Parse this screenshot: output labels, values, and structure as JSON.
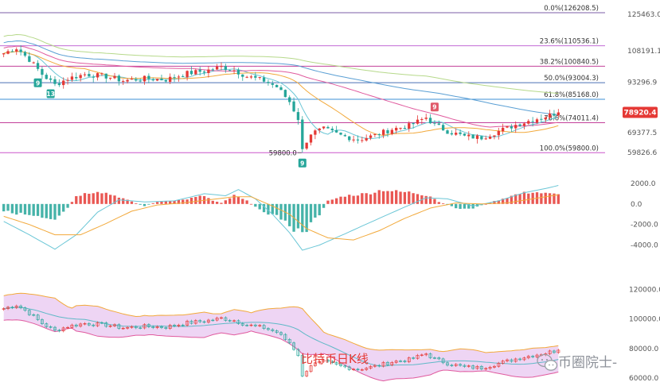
{
  "chart_data": [
    {
      "type": "candlestick",
      "panel": "price",
      "title": "",
      "ylim": [
        55000,
        130000
      ],
      "y_ticks": [
        "125463.0",
        "108191.1",
        "93296.9",
        "69377.5",
        "59826.6"
      ],
      "y_tick_values": [
        125463,
        108191.1,
        93296.9,
        69377.5,
        59826.6
      ],
      "fib_levels": [
        {
          "label": "0.0%(126208.5)",
          "value": 126208.5,
          "color": "#7b5ea7"
        },
        {
          "label": "23.6%(110536.1)",
          "value": 110536.1,
          "color": "#c26bd6"
        },
        {
          "label": "38.2%(100840.5)",
          "value": 100840.5,
          "color": "#c2409a"
        },
        {
          "label": "50.0%(93004.3)",
          "value": 93004.3,
          "color": "#4a6fb5"
        },
        {
          "label": "61.8%(85168.0)",
          "value": 85168.0,
          "color": "#3d8fd6"
        },
        {
          "label": "78.6%(74011.4)",
          "value": 74011.4,
          "color": "#c2409a"
        },
        {
          "label": "100.0%(59800.0)",
          "value": 59800.0,
          "color": "#cc55cc"
        }
      ],
      "last_price": {
        "label": "78920.4",
        "value": 78920.4,
        "color": "#e53935"
      },
      "low_annotation": {
        "label": "59800.0",
        "value": 59800.0
      },
      "td_markers": [
        {
          "label": "9",
          "kind": "buy",
          "candle": 8
        },
        {
          "label": "13",
          "kind": "buy",
          "candle": 11
        },
        {
          "label": "9",
          "kind": "buy",
          "candle": 70
        },
        {
          "label": "9",
          "kind": "sell",
          "candle": 101
        }
      ],
      "close_path": [
        {
          "candle": 0,
          "value": 107000
        },
        {
          "candle": 3,
          "value": 109500
        },
        {
          "candle": 6,
          "value": 104000
        },
        {
          "candle": 9,
          "value": 97000
        },
        {
          "candle": 12,
          "value": 92000
        },
        {
          "candle": 15,
          "value": 95000
        },
        {
          "candle": 19,
          "value": 97000
        },
        {
          "candle": 24,
          "value": 96000
        },
        {
          "candle": 28,
          "value": 94000
        },
        {
          "candle": 33,
          "value": 95000
        },
        {
          "candle": 38,
          "value": 94500
        },
        {
          "candle": 43,
          "value": 97500
        },
        {
          "candle": 47,
          "value": 98500
        },
        {
          "candle": 51,
          "value": 100500
        },
        {
          "candle": 54,
          "value": 99000
        },
        {
          "candle": 57,
          "value": 96000
        },
        {
          "candle": 61,
          "value": 94000
        },
        {
          "candle": 64,
          "value": 91000
        },
        {
          "candle": 67,
          "value": 84000
        },
        {
          "candle": 69,
          "value": 76000
        },
        {
          "candle": 70,
          "value": 62000
        },
        {
          "candle": 72,
          "value": 69000
        },
        {
          "candle": 75,
          "value": 71000
        },
        {
          "candle": 79,
          "value": 68000
        },
        {
          "candle": 83,
          "value": 66000
        },
        {
          "candle": 87,
          "value": 68000
        },
        {
          "candle": 91,
          "value": 71000
        },
        {
          "candle": 95,
          "value": 72500
        },
        {
          "candle": 99,
          "value": 76500
        },
        {
          "candle": 101,
          "value": 73000
        },
        {
          "candle": 104,
          "value": 70000
        },
        {
          "candle": 108,
          "value": 67500
        },
        {
          "candle": 112,
          "value": 67000
        },
        {
          "candle": 116,
          "value": 70000
        },
        {
          "candle": 120,
          "value": 73000
        },
        {
          "candle": 124,
          "value": 75500
        },
        {
          "candle": 127,
          "value": 77000
        },
        {
          "candle": 130,
          "value": 78920
        }
      ],
      "candle_count": 131
    },
    {
      "type": "bar+line",
      "panel": "macd",
      "title": "",
      "ylim": [
        -5500,
        3000
      ],
      "y_ticks": [
        "2000.0",
        "0.0",
        "-2000.0",
        "-4000.0"
      ],
      "y_tick_values": [
        2000,
        0,
        -2000,
        -4000
      ],
      "histogram_anchors": [
        {
          "bar": 0,
          "value": -700
        },
        {
          "bar": 6,
          "value": -1100
        },
        {
          "bar": 12,
          "value": -1700
        },
        {
          "bar": 15,
          "value": -400
        },
        {
          "bar": 17,
          "value": 800
        },
        {
          "bar": 22,
          "value": 1300
        },
        {
          "bar": 27,
          "value": 700
        },
        {
          "bar": 31,
          "value": 50
        },
        {
          "bar": 33,
          "value": -200
        },
        {
          "bar": 36,
          "value": 200
        },
        {
          "bar": 42,
          "value": 400
        },
        {
          "bar": 47,
          "value": 800
        },
        {
          "bar": 49,
          "value": 300
        },
        {
          "bar": 51,
          "value": 100
        },
        {
          "bar": 54,
          "value": 800
        },
        {
          "bar": 57,
          "value": 300
        },
        {
          "bar": 59,
          "value": -300
        },
        {
          "bar": 62,
          "value": -900
        },
        {
          "bar": 65,
          "value": -1400
        },
        {
          "bar": 68,
          "value": -2400
        },
        {
          "bar": 70,
          "value": -3000
        },
        {
          "bar": 72,
          "value": -2000
        },
        {
          "bar": 74,
          "value": -1000
        },
        {
          "bar": 76,
          "value": 300
        },
        {
          "bar": 80,
          "value": 800
        },
        {
          "bar": 85,
          "value": 1000
        },
        {
          "bar": 89,
          "value": 1400
        },
        {
          "bar": 92,
          "value": 1200
        },
        {
          "bar": 96,
          "value": 1100
        },
        {
          "bar": 100,
          "value": 800
        },
        {
          "bar": 102,
          "value": 200
        },
        {
          "bar": 104,
          "value": -100
        },
        {
          "bar": 107,
          "value": -500
        },
        {
          "bar": 110,
          "value": -400
        },
        {
          "bar": 113,
          "value": 0
        },
        {
          "bar": 116,
          "value": 400
        },
        {
          "bar": 120,
          "value": 900
        },
        {
          "bar": 124,
          "value": 1200
        },
        {
          "bar": 127,
          "value": 1000
        },
        {
          "bar": 130,
          "value": 900
        }
      ],
      "series": [
        {
          "name": "",
          "color": "#6ac6d6",
          "anchors": [
            {
              "bar": 0,
              "value": -1700
            },
            {
              "bar": 6,
              "value": -3000
            },
            {
              "bar": 12,
              "value": -4400
            },
            {
              "bar": 17,
              "value": -3000
            },
            {
              "bar": 22,
              "value": -800
            },
            {
              "bar": 27,
              "value": 400
            },
            {
              "bar": 33,
              "value": 200
            },
            {
              "bar": 40,
              "value": 300
            },
            {
              "bar": 47,
              "value": 1000
            },
            {
              "bar": 52,
              "value": 800
            },
            {
              "bar": 55,
              "value": 1400
            },
            {
              "bar": 59,
              "value": 500
            },
            {
              "bar": 63,
              "value": -1000
            },
            {
              "bar": 67,
              "value": -2800
            },
            {
              "bar": 70,
              "value": -4500
            },
            {
              "bar": 74,
              "value": -4000
            },
            {
              "bar": 80,
              "value": -2900
            },
            {
              "bar": 88,
              "value": -1400
            },
            {
              "bar": 94,
              "value": -300
            },
            {
              "bar": 99,
              "value": 600
            },
            {
              "bar": 104,
              "value": 500
            },
            {
              "bar": 110,
              "value": -200
            },
            {
              "bar": 116,
              "value": 300
            },
            {
              "bar": 122,
              "value": 1100
            },
            {
              "bar": 127,
              "value": 1500
            },
            {
              "bar": 130,
              "value": 1800
            }
          ]
        },
        {
          "name": "",
          "color": "#f2a93b",
          "anchors": [
            {
              "bar": 0,
              "value": -1200
            },
            {
              "bar": 6,
              "value": -2000
            },
            {
              "bar": 12,
              "value": -3000
            },
            {
              "bar": 18,
              "value": -3000
            },
            {
              "bar": 24,
              "value": -1900
            },
            {
              "bar": 30,
              "value": -700
            },
            {
              "bar": 36,
              "value": -100
            },
            {
              "bar": 42,
              "value": 100
            },
            {
              "bar": 48,
              "value": 400
            },
            {
              "bar": 54,
              "value": 700
            },
            {
              "bar": 58,
              "value": 700
            },
            {
              "bar": 63,
              "value": -200
            },
            {
              "bar": 67,
              "value": -1000
            },
            {
              "bar": 71,
              "value": -2400
            },
            {
              "bar": 76,
              "value": -3300
            },
            {
              "bar": 82,
              "value": -3500
            },
            {
              "bar": 88,
              "value": -2600
            },
            {
              "bar": 94,
              "value": -1400
            },
            {
              "bar": 100,
              "value": -400
            },
            {
              "bar": 106,
              "value": 100
            },
            {
              "bar": 112,
              "value": 0
            },
            {
              "bar": 118,
              "value": 100
            },
            {
              "bar": 124,
              "value": 500
            },
            {
              "bar": 130,
              "value": 900
            }
          ]
        }
      ]
    },
    {
      "type": "candlestick+band",
      "panel": "bollinger",
      "title": "",
      "ylim": [
        59000,
        124000
      ],
      "y_ticks": [
        "120000.0",
        "100000.0",
        "80000.0",
        "60000.0"
      ],
      "y_tick_values": [
        120000,
        100000,
        80000,
        60000
      ],
      "candle_count": 131
    }
  ],
  "caption": "比特币日K线",
  "watermark": {
    "brand_text": "币圈院士-",
    "icon": "wechat-icon"
  },
  "colors": {
    "up": "#e53935",
    "down": "#26a69a",
    "ma_colors": [
      "#6ac6d6",
      "#f2a93b",
      "#e05a9e",
      "#5a9fd4",
      "#b6d98a"
    ],
    "band_fill": "#e8c7f0",
    "band_upper": "#f2a93b",
    "band_lower": "#e05a9e",
    "band_mid": "#5fb9c7"
  }
}
